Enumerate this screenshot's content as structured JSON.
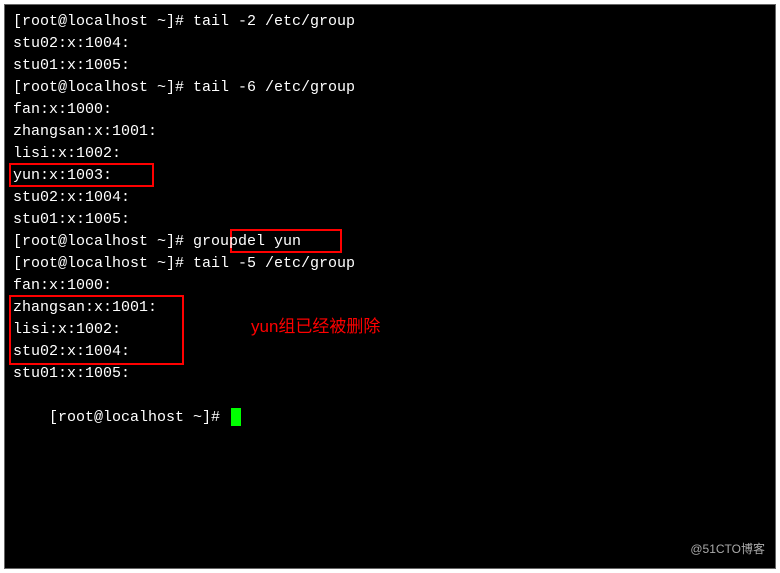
{
  "terminal": {
    "lines": [
      "[root@localhost ~]# tail -2 /etc/group",
      "stu02:x:1004:",
      "stu01:x:1005:",
      "[root@localhost ~]# tail -6 /etc/group",
      "fan:x:1000:",
      "zhangsan:x:1001:",
      "lisi:x:1002:",
      "yun:x:1003:",
      "stu02:x:1004:",
      "stu01:x:1005:",
      "[root@localhost ~]# groupdel yun",
      "[root@localhost ~]# tail -5 /etc/group",
      "fan:x:1000:",
      "zhangsan:x:1001:",
      "lisi:x:1002:",
      "stu02:x:1004:",
      "stu01:x:1005:",
      "[root@localhost ~]# "
    ]
  },
  "highlights": {
    "box1_target": "yun:x:1003:",
    "box2_target": "groupdel yun",
    "box3_target_lines": [
      "zhangsan:x:1001:",
      "lisi:x:1002:",
      "stu02:x:1004:"
    ]
  },
  "annotation": {
    "text": "yun组已经被删除"
  },
  "watermark": "@51CTO博客"
}
